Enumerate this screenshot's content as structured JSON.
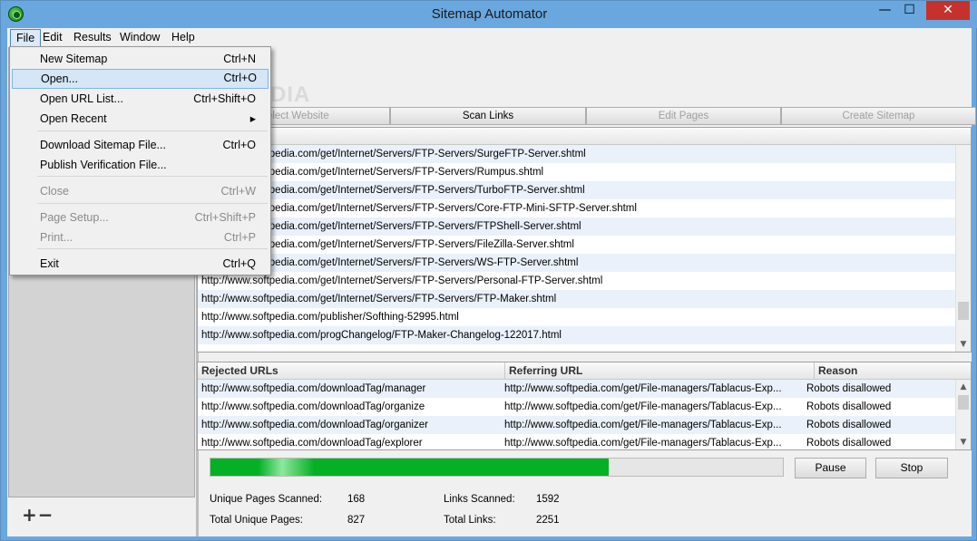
{
  "window": {
    "title": "Sitemap Automator",
    "min": "—",
    "max": "☐",
    "close": "✕"
  },
  "menubar": {
    "file": "File",
    "edit": "Edit",
    "results": "Results",
    "window": "Window",
    "help": "Help"
  },
  "file_menu": [
    {
      "label": "New Sitemap",
      "shortcut": "Ctrl+N",
      "enabled": true
    },
    {
      "label": "Open...",
      "shortcut": "Ctrl+O",
      "enabled": true,
      "highlighted": true
    },
    {
      "label": "Open URL List...",
      "shortcut": "Ctrl+Shift+O",
      "enabled": true
    },
    {
      "label": "Open Recent",
      "shortcut": "▸",
      "enabled": true
    },
    {
      "label": "Download Sitemap File...",
      "shortcut": "Ctrl+O",
      "enabled": true
    },
    {
      "label": "Publish Verification File...",
      "shortcut": "",
      "enabled": true
    },
    {
      "label": "Close",
      "shortcut": "Ctrl+W",
      "enabled": false
    },
    {
      "label": "Page Setup...",
      "shortcut": "Ctrl+Shift+P",
      "enabled": false
    },
    {
      "label": "Print...",
      "shortcut": "Ctrl+P",
      "enabled": false
    },
    {
      "label": "Exit",
      "shortcut": "Ctrl+Q",
      "enabled": true
    }
  ],
  "toolbar": {
    "select": "Select Website",
    "scan": "Scan Links",
    "edit": "Edit Pages",
    "create": "Create Sitemap"
  },
  "found": {
    "header": "URLs Found",
    "rows": [
      "http://www.softpedia.com/get/Internet/Servers/FTP-Servers/SurgeFTP-Server.shtml",
      "http://www.softpedia.com/get/Internet/Servers/FTP-Servers/Rumpus.shtml",
      "http://www.softpedia.com/get/Internet/Servers/FTP-Servers/TurboFTP-Server.shtml",
      "http://www.softpedia.com/get/Internet/Servers/FTP-Servers/Core-FTP-Mini-SFTP-Server.shtml",
      "http://www.softpedia.com/get/Internet/Servers/FTP-Servers/FTPShell-Server.shtml",
      "http://www.softpedia.com/get/Internet/Servers/FTP-Servers/FileZilla-Server.shtml",
      "http://www.softpedia.com/get/Internet/Servers/FTP-Servers/WS-FTP-Server.shtml",
      "http://www.softpedia.com/get/Internet/Servers/FTP-Servers/Personal-FTP-Server.shtml",
      "http://www.softpedia.com/get/Internet/Servers/FTP-Servers/FTP-Maker.shtml",
      "http://www.softpedia.com/publisher/Softhing-52995.html",
      "http://www.softpedia.com/progChangelog/FTP-Maker-Changelog-122017.html"
    ]
  },
  "rejected": {
    "headers": [
      "Rejected URLs",
      "Referring URL",
      "Reason"
    ],
    "rows": [
      [
        "http://www.softpedia.com/downloadTag/manager",
        "http://www.softpedia.com/get/File-managers/Tablacus-Exp...",
        "Robots disallowed"
      ],
      [
        "http://www.softpedia.com/downloadTag/organize",
        "http://www.softpedia.com/get/File-managers/Tablacus-Exp...",
        "Robots disallowed"
      ],
      [
        "http://www.softpedia.com/downloadTag/organizer",
        "http://www.softpedia.com/get/File-managers/Tablacus-Exp...",
        "Robots disallowed"
      ],
      [
        "http://www.softpedia.com/downloadTag/explorer",
        "http://www.softpedia.com/get/File-managers/Tablacus-Exp...",
        "Robots disallowed"
      ]
    ]
  },
  "progress": {
    "fraction": 0.695
  },
  "buttons": {
    "pause": "Pause",
    "stop": "Stop"
  },
  "stats": {
    "unique_pages_scanned_label": "Unique Pages Scanned:",
    "unique_pages_scanned": "168",
    "links_scanned_label": "Links Scanned:",
    "links_scanned": "1592",
    "total_unique_pages_label": "Total Unique Pages:",
    "total_unique_pages": "827",
    "total_links_label": "Total Links:",
    "total_links": "2251"
  },
  "sidebar": {
    "add_remove": "+−"
  },
  "watermark": "SOFTPEDIA"
}
